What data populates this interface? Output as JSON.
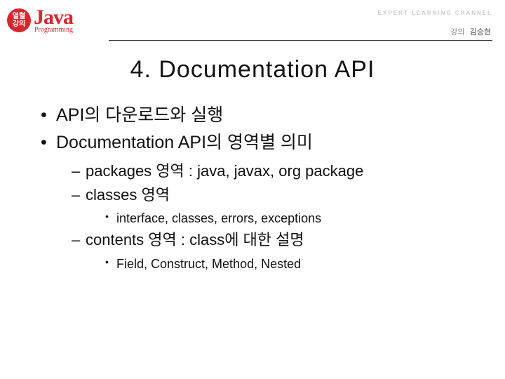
{
  "header": {
    "badge_line1": "열혈",
    "badge_line2": "강의",
    "logo_main": "Java",
    "logo_sub": "Programming",
    "channel": "EXPERT LEARNING CHANNEL",
    "lecturer_label": "강의",
    "lecturer_name": "김승현"
  },
  "title": "4. Documentation API",
  "bullets": {
    "b1": "API의 다운로드와 실행",
    "b2": "Documentation API의 영역별 의미",
    "b2_1": "packages 영역 : java, javax, org package",
    "b2_2": "classes 영역",
    "b2_2_1": "interface, classes, errors, exceptions",
    "b2_3": "contents 영역 : class에 대한 설명",
    "b2_3_1": "Field, Construct, Method, Nested"
  }
}
